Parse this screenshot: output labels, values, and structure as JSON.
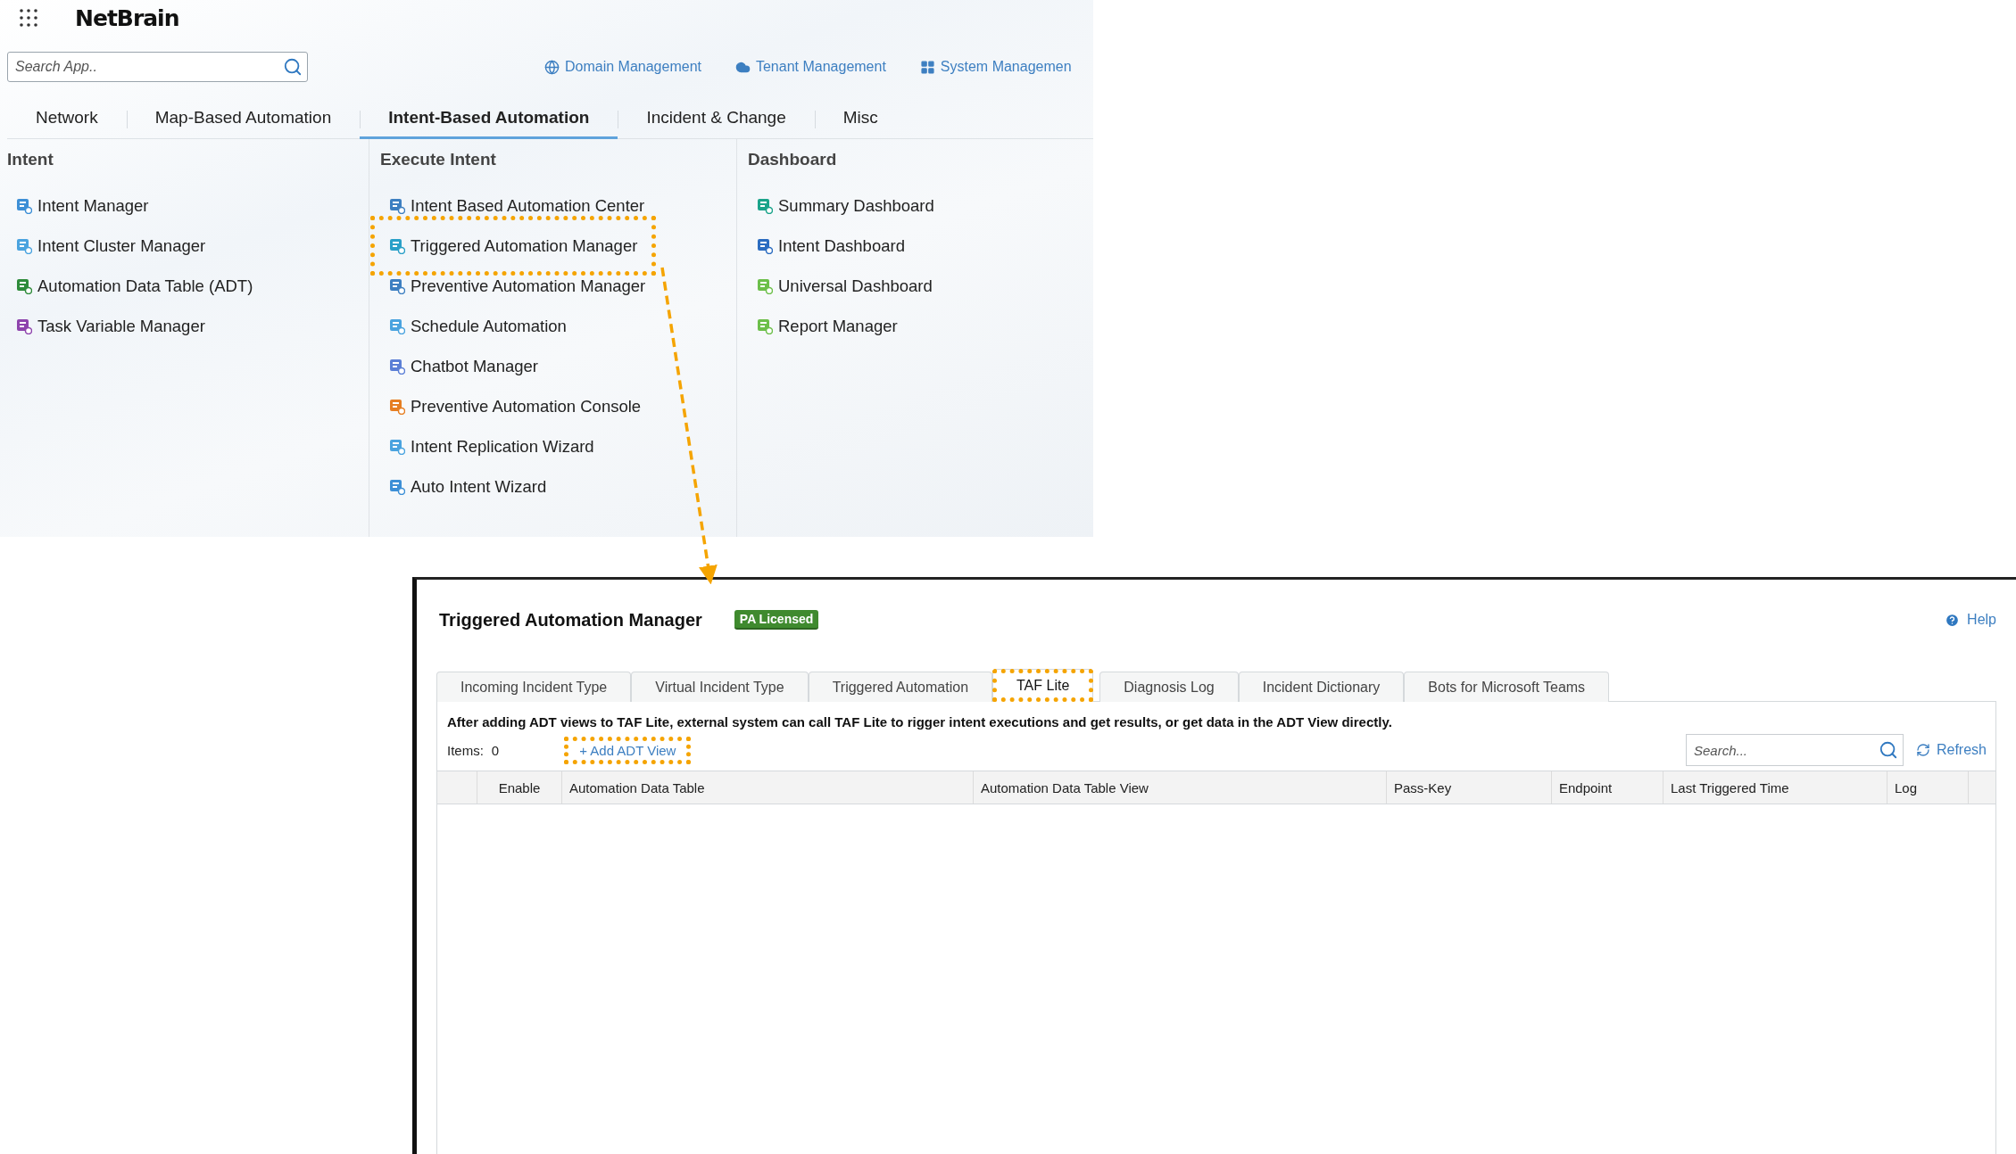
{
  "app": {
    "logo": "NetBrain",
    "search": {
      "placeholder": "Search App.."
    },
    "management_links": [
      {
        "label": "Domain Management",
        "kind": "globe"
      },
      {
        "label": "Tenant Management",
        "kind": "cloud"
      },
      {
        "label": "System Managemen",
        "kind": "grid"
      }
    ],
    "tabs": [
      {
        "label": "Network",
        "selected": false
      },
      {
        "label": "Map-Based Automation",
        "selected": false
      },
      {
        "label": "Intent-Based Automation",
        "selected": true
      },
      {
        "label": "Incident & Change",
        "selected": false
      },
      {
        "label": "Misc",
        "selected": false
      }
    ],
    "columns": [
      {
        "title": "Intent",
        "items": [
          {
            "label": "Intent Manager",
            "highlighted": false
          },
          {
            "label": "Intent Cluster Manager",
            "highlighted": false
          },
          {
            "label": "Automation Data Table (ADT)",
            "highlighted": false
          },
          {
            "label": "Task Variable Manager",
            "highlighted": false
          }
        ]
      },
      {
        "title": "Execute Intent",
        "items": [
          {
            "label": "Intent Based Automation Center",
            "highlighted": false
          },
          {
            "label": "Triggered Automation Manager",
            "highlighted": true
          },
          {
            "label": "Preventive Automation Manager",
            "highlighted": false
          },
          {
            "label": "Schedule Automation",
            "highlighted": false
          },
          {
            "label": "Chatbot Manager",
            "highlighted": false
          },
          {
            "label": "Preventive Automation Console",
            "highlighted": false
          },
          {
            "label": "Intent Replication Wizard",
            "highlighted": false
          },
          {
            "label": "Auto Intent Wizard",
            "highlighted": false
          }
        ]
      },
      {
        "title": "Dashboard",
        "items": [
          {
            "label": "Summary Dashboard",
            "highlighted": false
          },
          {
            "label": "Intent Dashboard",
            "highlighted": false
          },
          {
            "label": "Universal Dashboard",
            "highlighted": false
          },
          {
            "label": "Report Manager",
            "highlighted": false
          }
        ]
      }
    ]
  },
  "window": {
    "title": "Triggered Automation Manager",
    "badge": "PA Licensed",
    "help": "Help",
    "tabs": [
      {
        "label": "Incoming Incident Type",
        "selected": false,
        "highlighted": false
      },
      {
        "label": "Virtual Incident Type",
        "selected": false,
        "highlighted": false
      },
      {
        "label": "Triggered Automation",
        "selected": false,
        "highlighted": false
      },
      {
        "label": "TAF Lite",
        "selected": true,
        "highlighted": true
      },
      {
        "label": "Diagnosis Log",
        "selected": false,
        "highlighted": false
      },
      {
        "label": "Incident Dictionary",
        "selected": false,
        "highlighted": false
      },
      {
        "label": "Bots for Microsoft Teams",
        "selected": false,
        "highlighted": false
      }
    ],
    "description": "After adding ADT views to TAF Lite, external system can call TAF Lite to rigger intent executions and get results, or get data in the ADT View directly.",
    "items_label": "Items:",
    "items_count": "0",
    "add_button": {
      "label": "+ Add ADT View",
      "highlighted": true
    },
    "search": {
      "placeholder": "Search..."
    },
    "refresh": "Refresh",
    "table": {
      "columns": [
        "Enable",
        "Automation Data Table",
        "Automation Data Table View",
        "Pass-Key",
        "Endpoint",
        "Last Triggered Time",
        "Log"
      ]
    }
  }
}
